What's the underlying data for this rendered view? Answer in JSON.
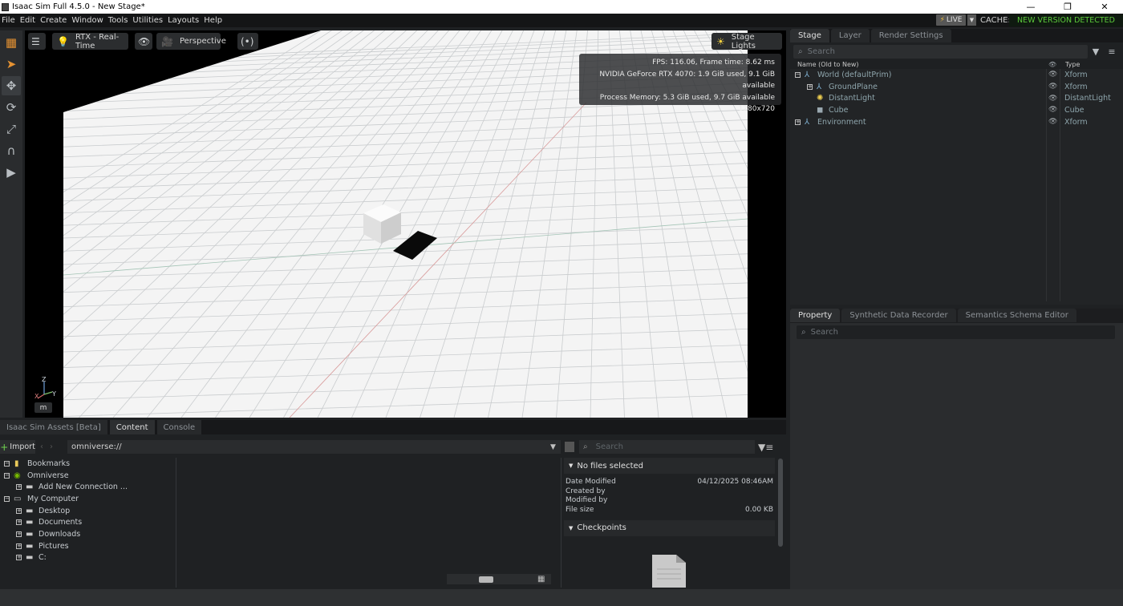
{
  "window": {
    "title": "Isaac Sim Full 4.5.0 - New Stage*",
    "min": "—",
    "max": "❐",
    "close": "✕"
  },
  "menu": {
    "items": [
      "File",
      "Edit",
      "Create",
      "Window",
      "Tools",
      "Utilities",
      "Layouts",
      "Help"
    ]
  },
  "status": {
    "live": "LIVE",
    "cache": "CACHE:",
    "new_version": "NEW VERSION DETECTED"
  },
  "viewport": {
    "renderer": "RTX - Real-Time",
    "camera": "Perspective",
    "lights": "Stage Lights",
    "stats": {
      "fps": "FPS: 116.06, Frame time: 8.62 ms",
      "gpu": "NVIDIA GeForce RTX 4070: 1.9 GiB used, 9.1 GiB available",
      "memory": "Process Memory: 5.3 GiB used, 9.7 GiB available",
      "resolution": "1280x720"
    },
    "axis_z": "Z",
    "axis_x": "X",
    "axis_y": "Y",
    "m_button": "m"
  },
  "stage": {
    "tabs": [
      "Stage",
      "Layer",
      "Render Settings"
    ],
    "search_placeholder": "Search",
    "col_name": "Name (Old to New)",
    "col_type": "Type",
    "rows": [
      {
        "name": "World (defaultPrim)",
        "type": "Xform"
      },
      {
        "name": "GroundPlane",
        "type": "Xform"
      },
      {
        "name": "DistantLight",
        "type": "DistantLight"
      },
      {
        "name": "Cube",
        "type": "Cube"
      },
      {
        "name": "Environment",
        "type": "Xform"
      }
    ]
  },
  "property": {
    "tabs": [
      "Property",
      "Synthetic Data Recorder",
      "Semantics Schema Editor"
    ],
    "search_placeholder": "Search"
  },
  "content": {
    "tabs": [
      "Isaac Sim Assets [Beta]",
      "Content",
      "Console"
    ],
    "import_label": "Import",
    "address": "omniverse://",
    "search_placeholder": "Search",
    "tree": [
      {
        "name": "Bookmarks"
      },
      {
        "name": "Omniverse"
      },
      {
        "name": "Add New Connection ..."
      },
      {
        "name": "My Computer"
      },
      {
        "name": "Desktop"
      },
      {
        "name": "Documents"
      },
      {
        "name": "Downloads"
      },
      {
        "name": "Pictures"
      },
      {
        "name": "C:"
      }
    ],
    "details": {
      "header": "No files selected",
      "date_modified_label": "Date Modified",
      "date_modified_value": "04/12/2025 08:46AM",
      "created_by_label": "Created by",
      "modified_by_label": "Modified by",
      "file_size_label": "File size",
      "file_size_value": "0.00 KB",
      "checkpoints": "Checkpoints"
    }
  },
  "colors": {
    "accent_green": "#5cc93b",
    "select_orange": "#e59232"
  }
}
